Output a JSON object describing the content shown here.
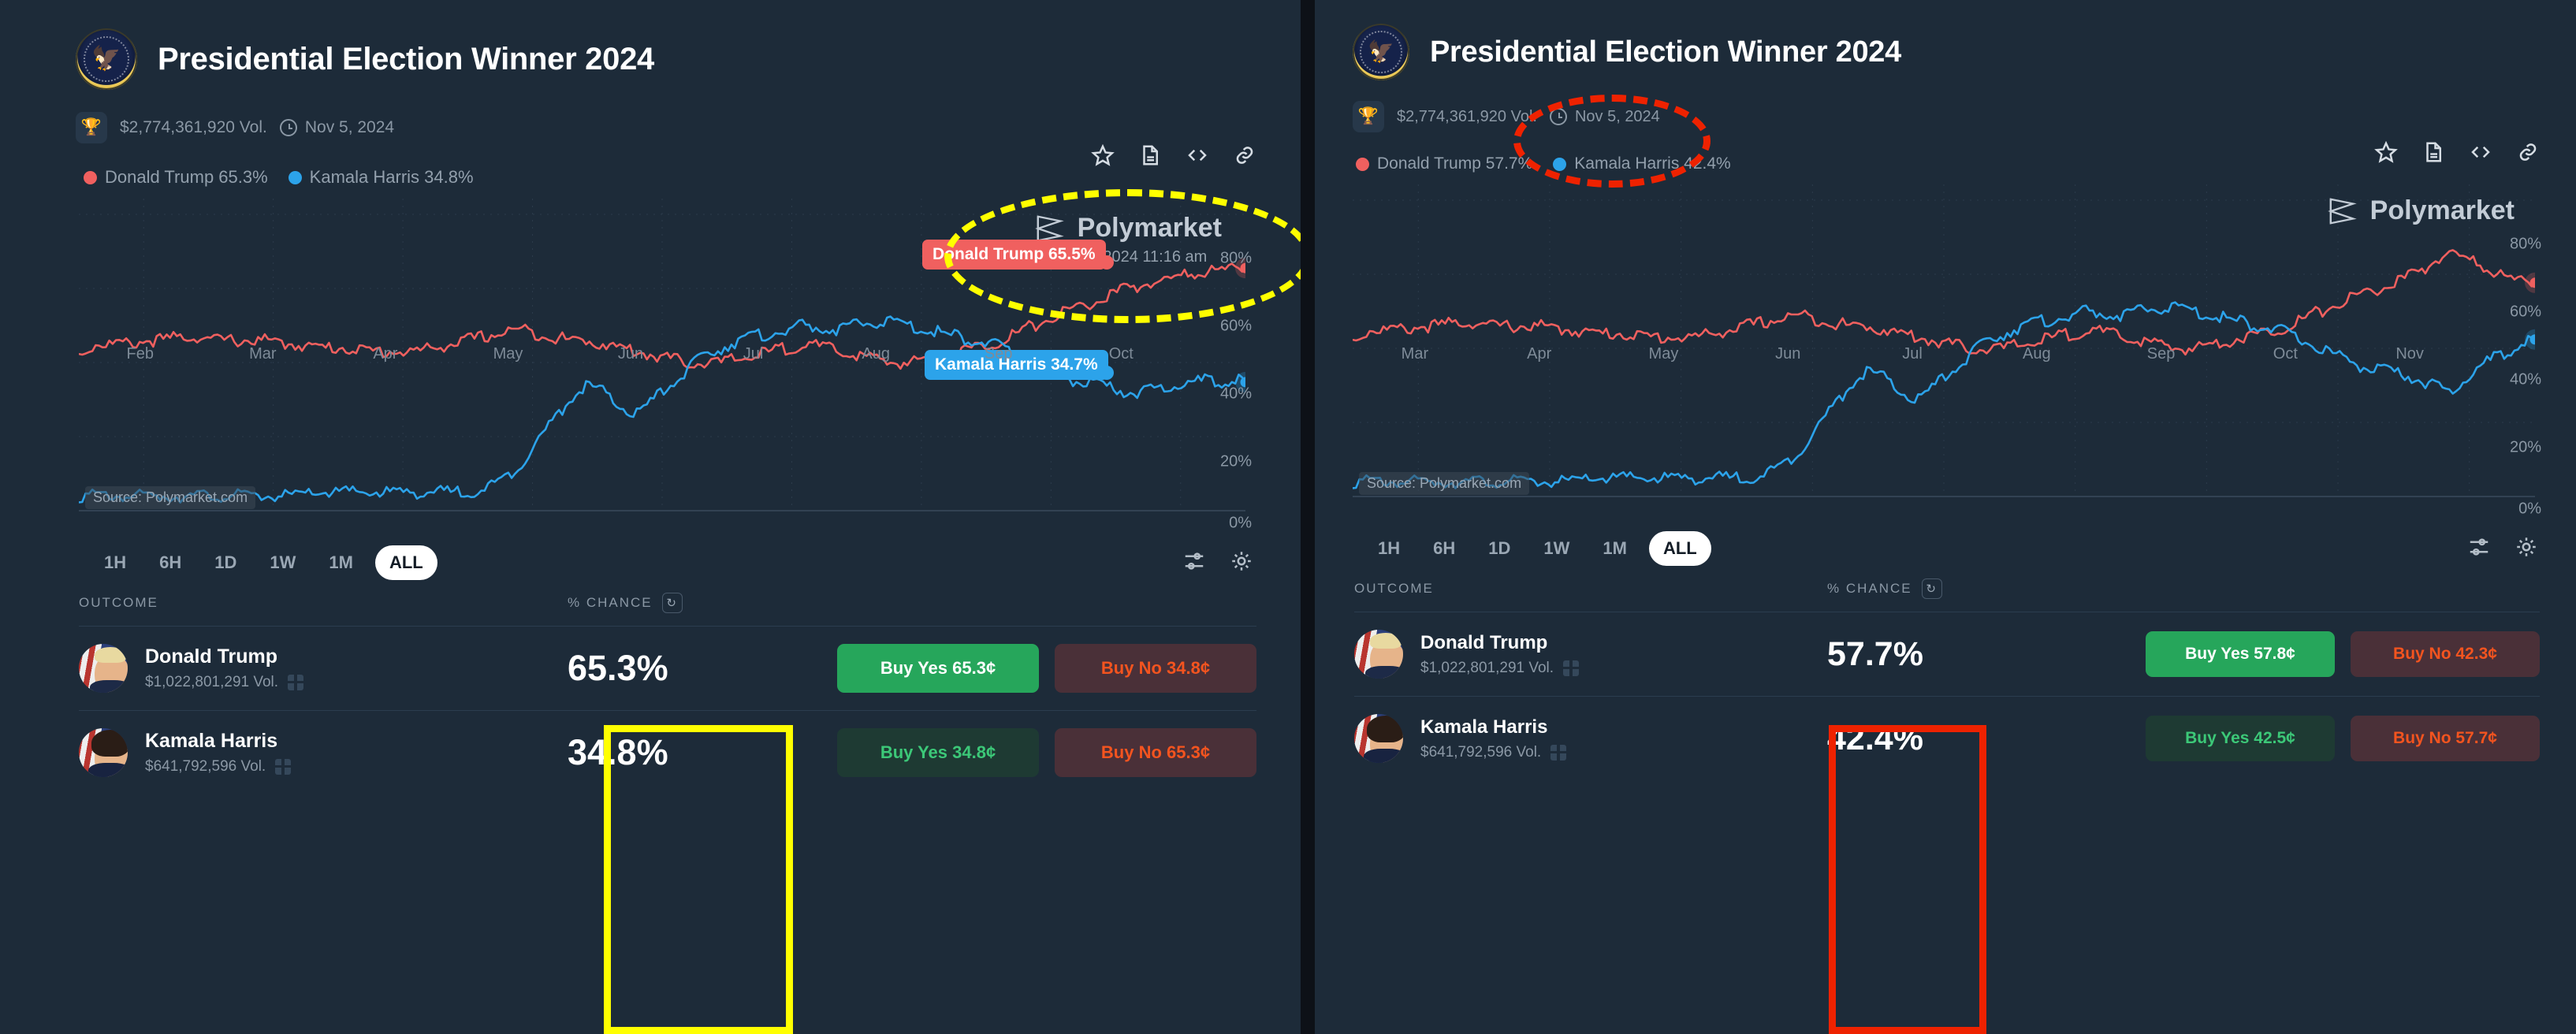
{
  "panels": [
    {
      "id": "left",
      "header": {
        "seal_icon": "presidential-seal-icon",
        "title": "Presidential Election Winner 2024"
      },
      "meta": {
        "trophy_icon": "trophy-icon",
        "volume": "$2,774,361,920 Vol.",
        "clock_icon": "clock-icon",
        "date": "Nov 5, 2024"
      },
      "header_icons": [
        "star-icon",
        "document-icon",
        "code-icon",
        "link-icon"
      ],
      "legend": [
        {
          "name": "Donald Trump 65.3%",
          "color": "#f0605f"
        },
        {
          "name": "Kamala Harris 34.8%",
          "color": "#2ca3ea"
        }
      ],
      "watermark": {
        "brand": "Polymarket",
        "timestamp": "Oct 31, 2024 11:16 am"
      },
      "source_tag": "Source: Polymarket.com",
      "tooltips": {
        "trump": "Donald Trump 65.5%",
        "harris": "Kamala Harris 34.7%"
      },
      "ranges": [
        "1H",
        "6H",
        "1D",
        "1W",
        "1M",
        "ALL"
      ],
      "range_active": "ALL",
      "range_tools": [
        "sliders-icon",
        "gear-icon"
      ],
      "table": {
        "headers": {
          "outcome": "OUTCOME",
          "chance": "% CHANCE",
          "refresh_icon": "refresh-icon"
        },
        "rows": [
          {
            "name": "Donald Trump",
            "volume": "$1,022,801,291 Vol.",
            "gift_icon": "gift-icon",
            "chance": "65.3%",
            "buy_yes": "Buy Yes 65.3¢",
            "buy_no": "Buy No 34.8¢",
            "yes_style": "strong"
          },
          {
            "name": "Kamala Harris",
            "volume": "$641,792,596 Vol.",
            "gift_icon": "gift-icon",
            "chance": "34.8%",
            "buy_yes": "Buy Yes 34.8¢",
            "buy_no": "Buy No 65.3¢",
            "yes_style": "dim"
          }
        ]
      },
      "chart_data": {
        "type": "line",
        "title": "Presidential Election Winner 2024",
        "xlabel": "",
        "ylabel": "% chance",
        "ylim": [
          0,
          80
        ],
        "yticks": [
          "0%",
          "20%",
          "40%",
          "60%",
          "80%"
        ],
        "xticks": [
          "Feb",
          "Mar",
          "Apr",
          "May",
          "Jun",
          "Jul",
          "Aug",
          "Sep",
          "Oct"
        ],
        "grid": true,
        "legend_position": "top-left",
        "series": [
          {
            "name": "Donald Trump",
            "color": "#f0605f",
            "end_value": 65.5,
            "values": [
              42,
              45,
              45,
              45,
              46,
              46,
              47,
              47,
              46,
              46,
              46,
              46,
              45,
              45,
              44,
              44,
              44,
              43,
              43,
              43,
              43,
              44,
              45,
              46,
              47,
              48,
              49,
              48,
              47,
              46,
              46,
              45,
              44,
              43,
              42,
              41,
              40,
              40,
              40,
              41,
              42,
              43,
              44,
              45,
              44,
              43,
              42,
              41,
              40,
              40,
              41,
              42,
              43,
              44,
              45,
              47,
              49,
              51,
              53,
              55,
              56,
              58,
              60,
              61,
              62,
              63,
              64,
              65,
              65,
              66
            ]
          },
          {
            "name": "Kamala Harris",
            "color": "#2ca3ea",
            "end_value": 34.7,
            "values": [
              4,
              4,
              4,
              4,
              4,
              4,
              4,
              4,
              4,
              4,
              4,
              4,
              4,
              4,
              5,
              5,
              5,
              5,
              5,
              5,
              5,
              5,
              5,
              5,
              6,
              8,
              12,
              18,
              24,
              30,
              34,
              32,
              28,
              26,
              30,
              34,
              38,
              42,
              44,
              46,
              47,
              48,
              49,
              50,
              49,
              49,
              50,
              51,
              51,
              50,
              49,
              48,
              47,
              46,
              45,
              43,
              41,
              39,
              37,
              35,
              34,
              33,
              32,
              32,
              33,
              34,
              35,
              35,
              35,
              35
            ]
          }
        ]
      }
    },
    {
      "id": "right",
      "header": {
        "seal_icon": "presidential-seal-icon",
        "title": "Presidential Election Winner 2024"
      },
      "meta": {
        "trophy_icon": "trophy-icon",
        "volume": "$2,774,361,920 Vol.",
        "clock_icon": "clock-icon",
        "date": "Nov 5, 2024"
      },
      "header_icons": [
        "star-icon",
        "document-icon",
        "code-icon",
        "link-icon"
      ],
      "legend": [
        {
          "name": "Donald Trump 57.7%",
          "color": "#f0605f"
        },
        {
          "name": "Kamala Harris 42.4%",
          "color": "#2ca3ea"
        }
      ],
      "watermark": {
        "brand": "Polymarket",
        "timestamp": ""
      },
      "source_tag": "Source: Polymarket.com",
      "tooltips": {
        "trump": "",
        "harris": ""
      },
      "ranges": [
        "1H",
        "6H",
        "1D",
        "1W",
        "1M",
        "ALL"
      ],
      "range_active": "ALL",
      "range_tools": [
        "sliders-icon",
        "gear-icon"
      ],
      "table": {
        "headers": {
          "outcome": "OUTCOME",
          "chance": "% CHANCE",
          "refresh_icon": "refresh-icon"
        },
        "rows": [
          {
            "name": "Donald Trump",
            "volume": "$1,022,801,291 Vol.",
            "gift_icon": "gift-icon",
            "chance": "57.7%",
            "buy_yes": "Buy Yes 57.8¢",
            "buy_no": "Buy No 42.3¢",
            "yes_style": "strong"
          },
          {
            "name": "Kamala Harris",
            "volume": "$641,792,596 Vol.",
            "gift_icon": "gift-icon",
            "chance": "42.4%",
            "buy_yes": "Buy Yes 42.5¢",
            "buy_no": "Buy No 57.7¢",
            "yes_style": "dim"
          }
        ]
      },
      "chart_data": {
        "type": "line",
        "title": "Presidential Election Winner 2024",
        "xlabel": "",
        "ylabel": "% chance",
        "ylim": [
          0,
          80
        ],
        "yticks": [
          "0%",
          "20%",
          "40%",
          "60%",
          "80%"
        ],
        "xticks": [
          "Mar",
          "Apr",
          "May",
          "Jun",
          "Jul",
          "Aug",
          "Sep",
          "Oct",
          "Nov"
        ],
        "grid": true,
        "legend_position": "top-left",
        "series": [
          {
            "name": "Donald Trump",
            "color": "#f0605f",
            "end_value": 57.7,
            "values": [
              42,
              45,
              45,
              45,
              46,
              46,
              47,
              47,
              46,
              46,
              46,
              46,
              45,
              45,
              44,
              44,
              44,
              43,
              43,
              43,
              43,
              44,
              45,
              46,
              47,
              48,
              49,
              48,
              47,
              46,
              46,
              45,
              44,
              43,
              42,
              41,
              40,
              40,
              40,
              41,
              42,
              43,
              44,
              45,
              44,
              43,
              42,
              41,
              40,
              40,
              41,
              42,
              43,
              44,
              45,
              47,
              49,
              51,
              53,
              55,
              56,
              58,
              60,
              63,
              66,
              64,
              62,
              60,
              58,
              58
            ]
          },
          {
            "name": "Kamala Harris",
            "color": "#2ca3ea",
            "end_value": 42.4,
            "values": [
              4,
              4,
              4,
              4,
              4,
              4,
              4,
              4,
              4,
              4,
              4,
              4,
              4,
              4,
              5,
              5,
              5,
              5,
              5,
              5,
              5,
              5,
              5,
              5,
              6,
              8,
              12,
              18,
              24,
              30,
              34,
              32,
              28,
              26,
              30,
              34,
              38,
              42,
              44,
              46,
              47,
              48,
              49,
              50,
              49,
              49,
              50,
              51,
              51,
              50,
              49,
              48,
              47,
              46,
              45,
              43,
              41,
              39,
              37,
              35,
              34,
              33,
              32,
              30,
              28,
              32,
              36,
              38,
              41,
              42
            ]
          }
        ]
      }
    }
  ],
  "annotations": [
    {
      "name": "yellow-ellipse-watermark",
      "shape": "ellipse",
      "color": "#ffff00"
    },
    {
      "name": "yellow-rect-chance-column",
      "shape": "rect",
      "color": "#ffff00"
    },
    {
      "name": "red-ellipse-date",
      "shape": "ellipse",
      "color": "#ee2200"
    },
    {
      "name": "red-rect-chance-column",
      "shape": "rect",
      "color": "#ee2200"
    }
  ]
}
